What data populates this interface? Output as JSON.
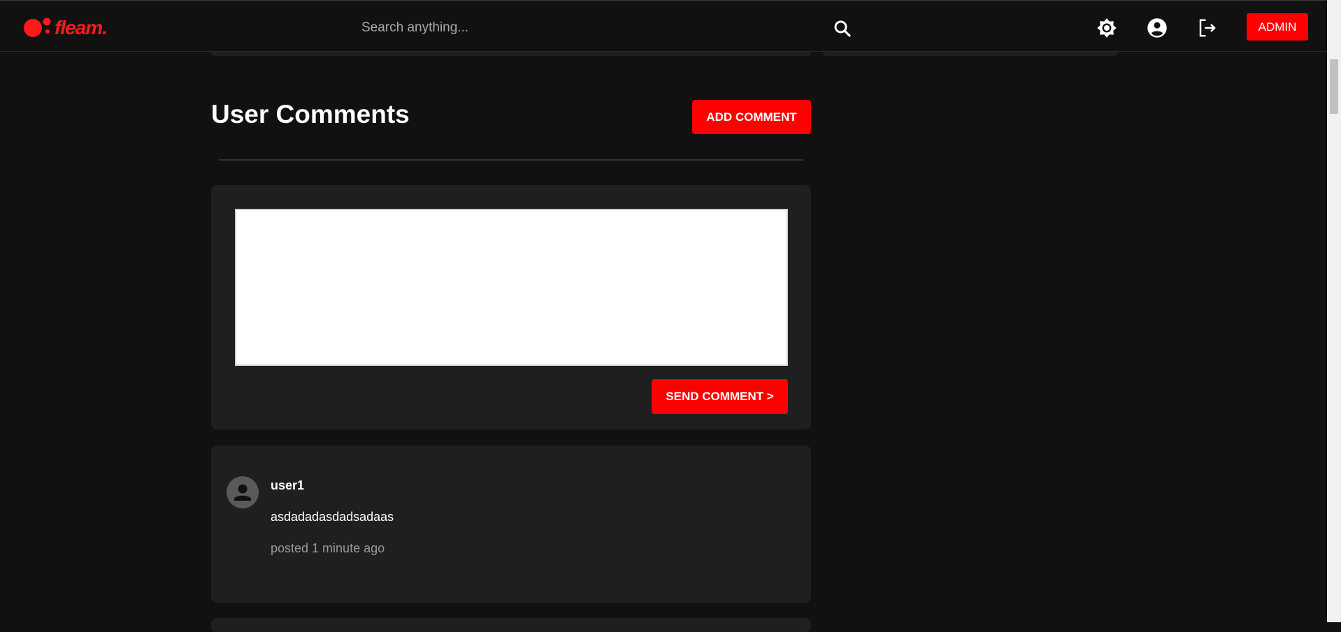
{
  "header": {
    "logo_text": "fleam.",
    "search_placeholder": "Search anything...",
    "admin_label": "ADMIN"
  },
  "icons": {
    "search": "search-icon",
    "theme": "brightness-icon",
    "account": "account-circle-icon",
    "logout": "logout-icon",
    "avatar": "person-icon"
  },
  "comments_section": {
    "title": "User Comments",
    "add_label": "ADD COMMENT",
    "send_label": "SEND COMMENT >",
    "textarea_value": ""
  },
  "comments": [
    {
      "user": "user1",
      "text": "asdadadasdadsadaas",
      "time": "posted 1 minute ago"
    }
  ],
  "colors": {
    "accent": "#ff0000",
    "background": "#111111",
    "card": "#1f1f1f",
    "muted_text": "#9a9a9a"
  }
}
